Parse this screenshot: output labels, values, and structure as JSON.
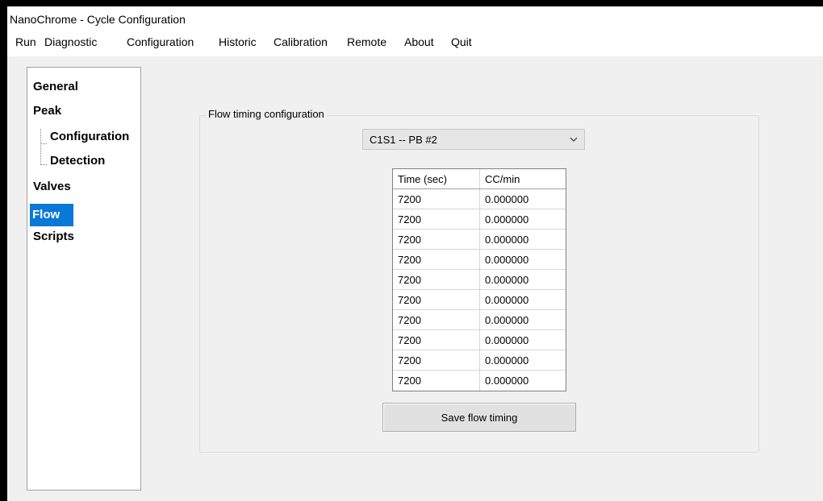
{
  "window": {
    "title": "NanoChrome - Cycle Configuration"
  },
  "menu": [
    "Run",
    "Diagnostic",
    "Configuration",
    "Historic",
    "Calibration",
    "Remote",
    "About",
    "Quit"
  ],
  "tree": {
    "items": [
      "General",
      "Peak",
      "Configuration",
      "Detection",
      "Valves",
      "Flow",
      "Scripts"
    ],
    "selected": "Flow"
  },
  "flow_timing": {
    "group_label": "Flow timing configuration",
    "selector_value": "C1S1 -- PB #2",
    "columns": [
      "Time (sec)",
      "CC/min"
    ],
    "rows": [
      [
        "7200",
        "0.000000"
      ],
      [
        "7200",
        "0.000000"
      ],
      [
        "7200",
        "0.000000"
      ],
      [
        "7200",
        "0.000000"
      ],
      [
        "7200",
        "0.000000"
      ],
      [
        "7200",
        "0.000000"
      ],
      [
        "7200",
        "0.000000"
      ],
      [
        "7200",
        "0.000000"
      ],
      [
        "7200",
        "0.000000"
      ],
      [
        "7200",
        "0.000000"
      ]
    ],
    "save_label": "Save flow timing"
  },
  "colors": {
    "selection": "#0a78d7",
    "window_bg": "#f0f0f0"
  }
}
